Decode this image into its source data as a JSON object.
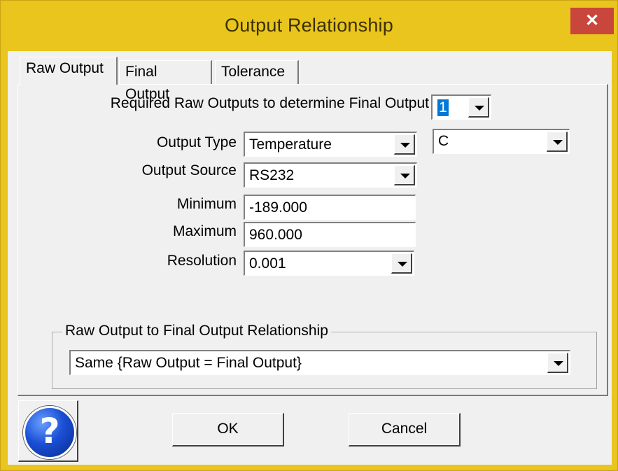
{
  "window": {
    "title": "Output Relationship",
    "close_glyph": "✕"
  },
  "tabs": [
    "Raw Output",
    "Final Output",
    "Tolerance"
  ],
  "form": {
    "required_label": "Required Raw Outputs to determine Final Output",
    "required_value": "1",
    "output_type_label": "Output Type",
    "output_type_value": "Temperature",
    "unit_value": "C",
    "output_source_label": "Output Source",
    "output_source_value": "RS232",
    "minimum_label": "Minimum",
    "minimum_value": "-189.000",
    "maximum_label": "Maximum",
    "maximum_value": "960.000",
    "resolution_label": "Resolution",
    "resolution_value": "0.001"
  },
  "relationship": {
    "group_label": "Raw Output to Final Output Relationship",
    "value": "Same {Raw Output = Final Output}"
  },
  "buttons": {
    "ok": "OK",
    "cancel": "Cancel",
    "help_glyph": "?"
  },
  "icons": {
    "help": "help-question-icon",
    "close": "close-icon",
    "dropdown": "chevron-down-icon"
  },
  "colors": {
    "title_bar": "#e9c51d",
    "close": "#c9463d",
    "help_blue": "#1a4fd6",
    "selection": "#0078d7"
  }
}
